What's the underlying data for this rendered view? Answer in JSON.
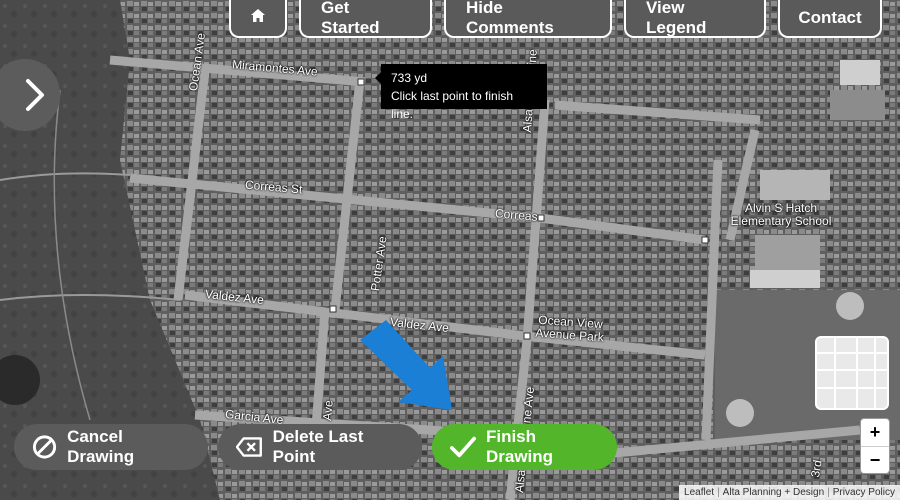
{
  "nav": {
    "home_icon": "home-icon",
    "get_started": "Get Started",
    "hide_comments": "Hide Comments",
    "view_legend": "View Legend",
    "contact": "Contact"
  },
  "side_toggle_icon": "chevron-right-icon",
  "tooltip": {
    "distance": "733 yd",
    "hint": "Click last point to finish line."
  },
  "streets": {
    "miramontes": "Miramontes Ave",
    "ocean_ave": "Ocean Ave",
    "correas_st": "Correas St",
    "correas": "Correas",
    "alsace_lorraine_top": "Alsace Lorraine",
    "potter": "Potter Ave",
    "valdez": "Valdez Ave",
    "valdez_2": "Valdez Ave",
    "garcia": "Garcia Ave",
    "alsace_lorraine_bottom": "Alsace Lorraine Ave",
    "ocean_ave_2": "Ave",
    "third": "3rd"
  },
  "places": {
    "school": "Alvin S Hatch Elementary School",
    "park": "Ocean View Avenue Park"
  },
  "controls": {
    "cancel": "Cancel Drawing",
    "delete": "Delete Last Point",
    "finish": "Finish Drawing"
  },
  "zoom": {
    "in": "+",
    "out": "−"
  },
  "attribution": {
    "leaflet": "Leaflet",
    "alta": "Alta Planning + Design",
    "privacy": "Privacy Policy"
  },
  "colors": {
    "finish_green": "#52b52a",
    "arrow_blue": "#1b7fd6",
    "button_gray": "#5b5b5b"
  }
}
